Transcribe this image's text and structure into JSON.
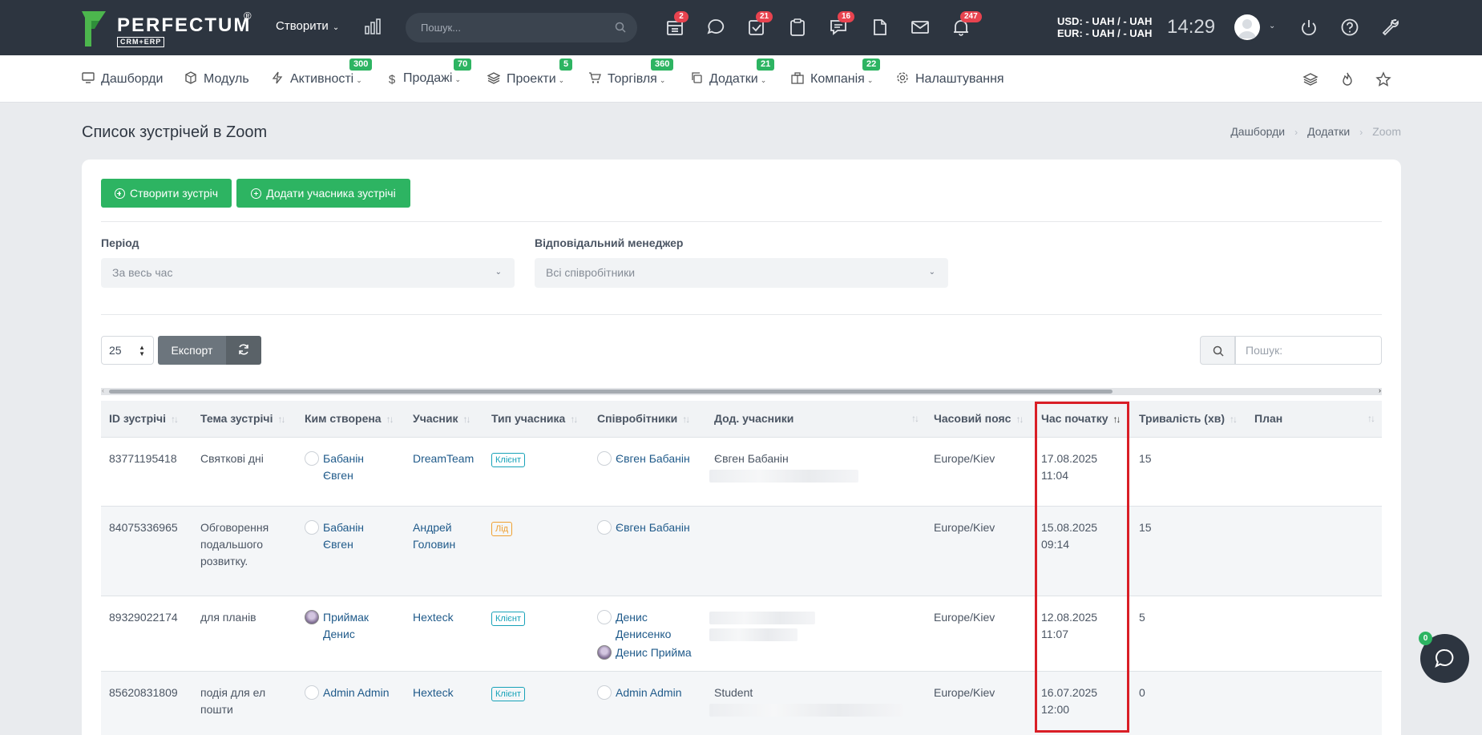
{
  "topbar": {
    "logo_text": "PERFECTUM",
    "logo_sub": "CRM+ERP",
    "logo_reg": "®",
    "create_label": "Створити",
    "search_placeholder": "Пошук...",
    "icons": [
      {
        "name": "calendar-icon",
        "badge": "2"
      },
      {
        "name": "chat-icon",
        "badge": ""
      },
      {
        "name": "tasks-icon",
        "badge": "21"
      },
      {
        "name": "clipboard-icon",
        "badge": ""
      },
      {
        "name": "messages-icon",
        "badge": "16"
      },
      {
        "name": "document-icon",
        "badge": ""
      },
      {
        "name": "mail-icon",
        "badge": ""
      },
      {
        "name": "bell-icon",
        "badge": "247"
      }
    ],
    "currency_usd": "USD: - UAH / - UAH",
    "currency_eur": "EUR: - UAH / - UAH",
    "time": "14:29"
  },
  "nav": {
    "items": [
      {
        "label": "Дашборди",
        "badge": "",
        "icon": "monitor-icon"
      },
      {
        "label": "Модуль",
        "badge": "",
        "icon": "cube-icon"
      },
      {
        "label": "Активності",
        "badge": "300",
        "icon": "bolt-icon"
      },
      {
        "label": "Продажі",
        "badge": "70",
        "icon": "dollar-icon"
      },
      {
        "label": "Проекти",
        "badge": "5",
        "icon": "layers-icon"
      },
      {
        "label": "Торгівля",
        "badge": "360",
        "icon": "cart-icon"
      },
      {
        "label": "Додатки",
        "badge": "21",
        "icon": "copy-icon"
      },
      {
        "label": "Компанія",
        "badge": "22",
        "icon": "building-icon"
      },
      {
        "label": "Налаштування",
        "badge": "",
        "icon": "gear-icon"
      }
    ]
  },
  "page": {
    "title": "Список зустрічей в Zoom",
    "breadcrumb": [
      "Дашборди",
      "Додатки",
      "Zoom"
    ]
  },
  "actions": {
    "create_meeting": "Створити зустріч",
    "add_participant": "Додати учасника зустрічі"
  },
  "filters": {
    "period_label": "Період",
    "period_value": "За весь час",
    "manager_label": "Відповідальний менеджер",
    "manager_value": "Всі співробітники"
  },
  "table_controls": {
    "per_page": "25",
    "export_label": "Експорт",
    "search_placeholder": "Пошук:"
  },
  "table": {
    "columns": [
      "ID зустрічі",
      "Тема зустрічі",
      "Ким створена",
      "Учасник",
      "Тип учасника",
      "Співробітники",
      "Дод. учасники",
      "Часовий пояс",
      "Час початку",
      "Тривалість (хв)",
      "План"
    ],
    "rows": [
      {
        "id": "83771195418",
        "topic": "Святкові дні",
        "creator_first": "Бабанін",
        "creator_second": "Євген",
        "participant": "DreamTeam",
        "ptype": "Клієнт",
        "ptype_kind": "client",
        "employees": [
          "Євген Бабанін"
        ],
        "extra": "Євген Бабанін",
        "tz": "Europe/Kiev",
        "date": "17.08.2025",
        "time": "11:04",
        "duration": "15",
        "plan": ""
      },
      {
        "id": "84075336965",
        "topic": "Обговорення подальшого розвитку.",
        "creator_first": "Бабанін",
        "creator_second": "Євген",
        "participant": "Андрей Головин",
        "ptype": "Лід",
        "ptype_kind": "lead",
        "employees": [
          "Євген Бабанін"
        ],
        "extra": "",
        "tz": "Europe/Kiev",
        "date": "15.08.2025",
        "time": "09:14",
        "duration": "15",
        "plan": ""
      },
      {
        "id": "89329022174",
        "topic": "для планів",
        "creator_first": "Приймак",
        "creator_second": "Денис",
        "participant": "Hexteck",
        "ptype": "Клієнт",
        "ptype_kind": "client",
        "employees": [
          "Денис Денисенко",
          "Денис Прийма"
        ],
        "extra": "",
        "tz": "Europe/Kiev",
        "date": "12.08.2025",
        "time": "11:07",
        "duration": "5",
        "plan": ""
      },
      {
        "id": "85620831809",
        "topic": "подія для ел пошти",
        "creator_first": "Admin Admin",
        "creator_second": "",
        "participant": "Hexteck",
        "ptype": "Клієнт",
        "ptype_kind": "client",
        "employees": [
          "Admin Admin"
        ],
        "extra": "Student",
        "tz": "Europe/Kiev",
        "date": "16.07.2025",
        "time": "12:00",
        "duration": "0",
        "plan": ""
      }
    ]
  },
  "chat_fab": {
    "badge": "0"
  },
  "colors": {
    "topbar": "#2d3540",
    "accent_green": "#2db462",
    "badge_red": "#e8434f",
    "highlight": "#d91e26"
  }
}
